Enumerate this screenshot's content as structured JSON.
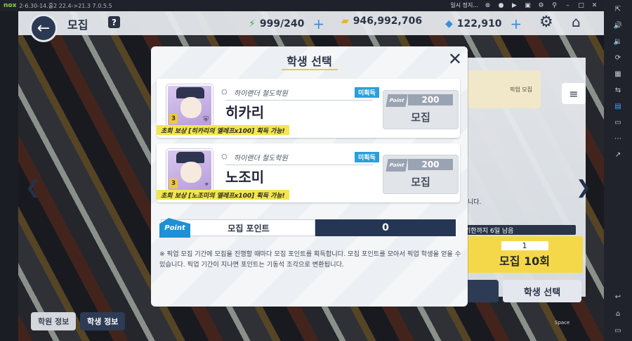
{
  "emulator": {
    "logo": "nox",
    "version_text": "2-6.30-14.홀2 22.4->21.3 7.0.5.5",
    "pause_label": "일시 정지..."
  },
  "hud": {
    "title": "모집",
    "help": "?",
    "energy": "999/240",
    "credits": "946,992,706",
    "gems": "122,910"
  },
  "modal": {
    "title": "학생 선택",
    "students": [
      {
        "school": "하이랜더 철도학원",
        "name": "히카리",
        "status": "미획득",
        "star": "3",
        "reward": "초회 보상 [히카리의 엘레프x100] 획득 가능!",
        "cost": "200",
        "point_tag": "Point",
        "button": "모집"
      },
      {
        "school": "하이랜더 철도학원",
        "name": "노조미",
        "status": "미획득",
        "star": "3",
        "reward": "초회 보상 [노조미의 엘레프x100] 획득 가능!",
        "cost": "200",
        "point_tag": "Point",
        "button": "모집"
      }
    ],
    "point_badge": "Point",
    "point_label": "모집 포인트",
    "point_value": "0",
    "notice": "※ 픽업 모집 기간에 모집을 진행할 때마다 모집 포인트를 획득합니다. 모집 포인트를 모아서 픽업 학생을 얻을 수 있습니다. 픽업 기간이 지나면 포인트는 기동석 조각으로 변환됩니다."
  },
  "background": {
    "banner": "픽업 모집",
    "info": "니다.",
    "limit": "기한까지 6일 남음",
    "gacha_count": "1",
    "gacha10": "모집 10회",
    "select": "학생 선택",
    "tab_school": "학원 정보",
    "tab_student": "학생 정보",
    "space": "Space"
  },
  "colors": {
    "accent": "#29a0dc",
    "navy": "#243653",
    "yellow": "#f3e64c"
  }
}
